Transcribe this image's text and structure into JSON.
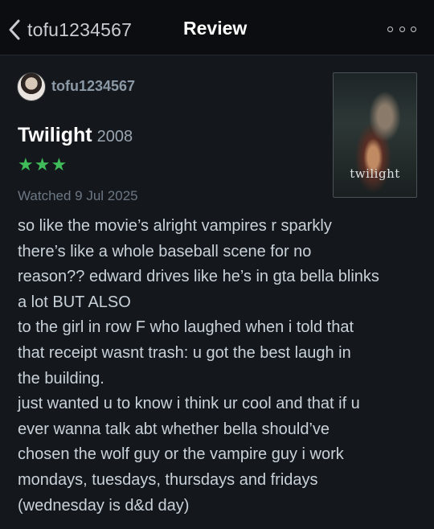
{
  "header": {
    "back_label": "tofu1234567",
    "title": "Review"
  },
  "author": {
    "username": "tofu1234567"
  },
  "film": {
    "title": "Twilight",
    "year": "2008",
    "rating_stars": "★★★",
    "rating_value": 3,
    "watched": "Watched 9 Jul 2025",
    "poster_text": "twilight"
  },
  "review": {
    "lines": [
      "so like the movie’s alright vampires r sparkly",
      "there’s like a whole baseball scene for no",
      "reason?? edward drives like he’s in gta bella blinks",
      "a lot BUT ALSO",
      "to the girl in row F who laughed when i told that",
      "that receipt wasnt trash: u got the best laugh in",
      "the building.",
      "just wanted u to know i think ur cool and that if u",
      "ever wanna talk abt whether bella should’ve",
      "chosen the wolf guy or the vampire guy i work",
      "mondays, tuesdays, thursdays and fridays",
      "(wednesday is d&d day)"
    ]
  },
  "colors": {
    "background": "#14181c",
    "topbar": "#0b0d10",
    "star_green": "#40bc5a",
    "muted": "#6c7783"
  }
}
